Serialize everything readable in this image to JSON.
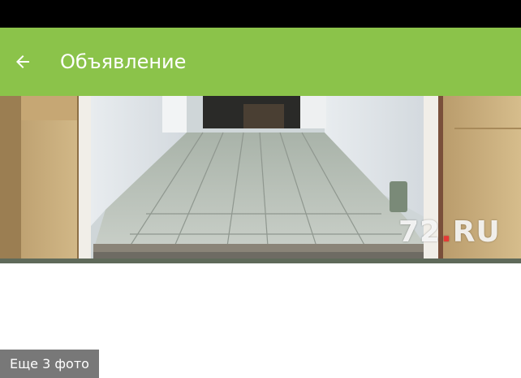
{
  "header": {
    "title": "Объявление",
    "back_icon": "arrow-back-icon",
    "background_color": "#8bc34a"
  },
  "photo": {
    "watermark_prefix": "72",
    "watermark_dot": ".",
    "watermark_suffix": "RU",
    "more_photos_label": "Еще 3 фото"
  }
}
